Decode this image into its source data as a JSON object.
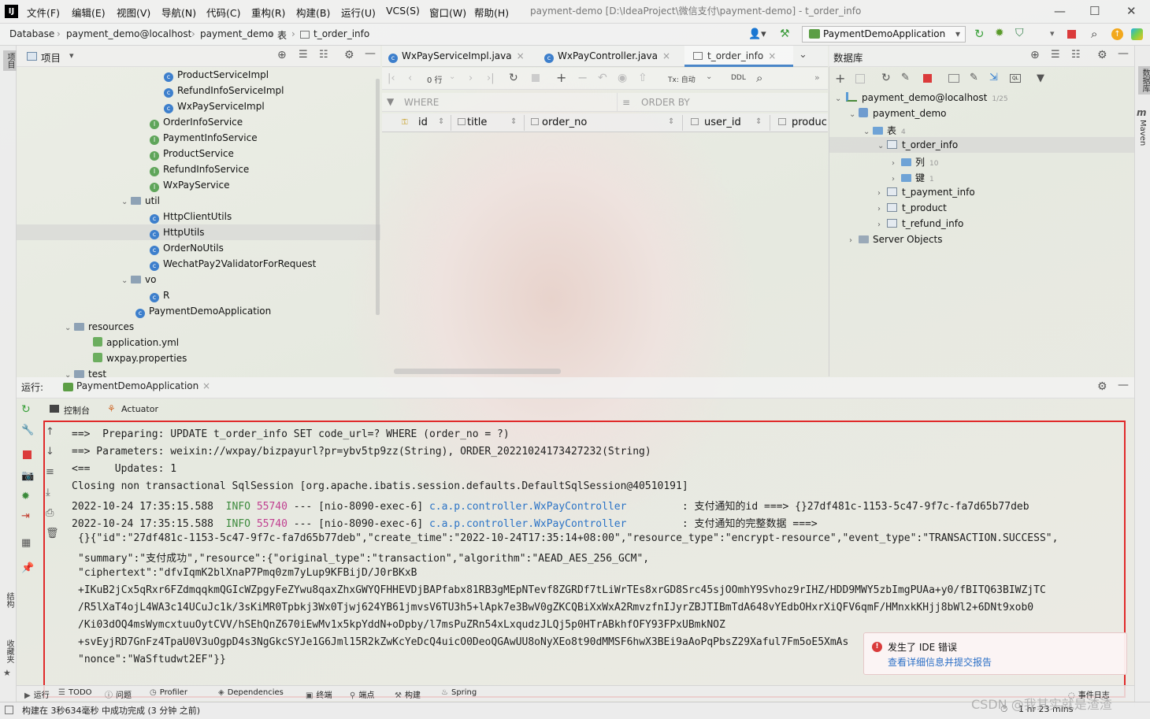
{
  "menu": {
    "items": [
      "文件(F)",
      "编辑(E)",
      "视图(V)",
      "导航(N)",
      "代码(C)",
      "重构(R)",
      "构建(B)",
      "运行(U)",
      "VCS(S)",
      "窗口(W)",
      "帮助(H)"
    ]
  },
  "window": {
    "title": "payment-demo [D:\\IdeaProject\\微信支付\\payment-demo] - t_order_info"
  },
  "breadcrumb": [
    "Database",
    "payment_demo@localhost",
    "payment_demo",
    "表",
    "t_order_info"
  ],
  "run_config": "PaymentDemoApplication",
  "project": {
    "title": "项目",
    "items": [
      {
        "label": "ProductServiceImpl",
        "kind": "class",
        "indent": 3
      },
      {
        "label": "RefundInfoServiceImpl",
        "kind": "class",
        "indent": 3
      },
      {
        "label": "WxPayServiceImpl",
        "kind": "class",
        "indent": 3
      },
      {
        "label": "OrderInfoService",
        "kind": "interface",
        "indent": 2
      },
      {
        "label": "PaymentInfoService",
        "kind": "interface",
        "indent": 2
      },
      {
        "label": "ProductService",
        "kind": "interface",
        "indent": 2
      },
      {
        "label": "RefundInfoService",
        "kind": "interface",
        "indent": 2
      },
      {
        "label": "WxPayService",
        "kind": "interface",
        "indent": 2
      },
      {
        "label": "util",
        "kind": "folder",
        "indent": 1,
        "open": true
      },
      {
        "label": "HttpClientUtils",
        "kind": "class",
        "indent": 2
      },
      {
        "label": "HttpUtils",
        "kind": "class",
        "indent": 2
      },
      {
        "label": "OrderNoUtils",
        "kind": "class",
        "indent": 2
      },
      {
        "label": "WechatPay2ValidatorForRequest",
        "kind": "class",
        "indent": 2
      },
      {
        "label": "vo",
        "kind": "folder",
        "indent": 1,
        "open": true
      },
      {
        "label": "R",
        "kind": "class",
        "indent": 2
      },
      {
        "label": "PaymentDemoApplication",
        "kind": "class",
        "indent": 1
      },
      {
        "label": "resources",
        "kind": "folder",
        "indent": 0,
        "open": true
      },
      {
        "label": "application.yml",
        "kind": "yml",
        "indent": 1
      },
      {
        "label": "wxpay.properties",
        "kind": "yml",
        "indent": 1
      },
      {
        "label": "test",
        "kind": "folder",
        "indent": 0,
        "open": true
      }
    ]
  },
  "editor": {
    "tabs": [
      "WxPayServiceImpl.java",
      "WxPayController.java",
      "t_order_info"
    ],
    "rows_label": "0 行",
    "tx_label": "Tx: 自动",
    "ddl_label": "DDL",
    "where_label": "WHERE",
    "orderby_label": "ORDER BY",
    "columns": [
      "id",
      "title",
      "order_no",
      "user_id",
      "produc"
    ]
  },
  "database": {
    "title": "数据库",
    "nodes": [
      {
        "label": "payment_demo@localhost",
        "badge": "1/25",
        "level": 0,
        "arrow": "open"
      },
      {
        "label": "payment_demo",
        "badge": "",
        "level": 1,
        "arrow": "open"
      },
      {
        "label": "表",
        "badge": "4",
        "level": 2,
        "arrow": "open"
      },
      {
        "label": "t_order_info",
        "badge": "",
        "level": 3,
        "arrow": "open"
      },
      {
        "label": "列",
        "badge": "10",
        "level": 4,
        "arrow": "closed"
      },
      {
        "label": "键",
        "badge": "1",
        "level": 4,
        "arrow": "closed"
      },
      {
        "label": "t_payment_info",
        "badge": "",
        "level": 3,
        "arrow": "closed"
      },
      {
        "label": "t_product",
        "badge": "",
        "level": 3,
        "arrow": "closed"
      },
      {
        "label": "t_refund_info",
        "badge": "",
        "level": 3,
        "arrow": "closed"
      },
      {
        "label": "Server Objects",
        "badge": "",
        "level": 1,
        "arrow": "closed"
      }
    ]
  },
  "run": {
    "label": "运行:",
    "tab": "PaymentDemoApplication",
    "console_tab": "控制台",
    "actuator_tab": "Actuator"
  },
  "console": {
    "lines": [
      "==>  Preparing: UPDATE t_order_info SET code_url=? WHERE (order_no = ?)",
      "==> Parameters: weixin://wxpay/bizpayurl?pr=ybv5tp9zz(String), ORDER_20221024173427232(String)",
      "<==    Updates: 1",
      "Closing non transactional SqlSession [org.apache.ibatis.session.defaults.DefaultSqlSession@40510191]"
    ],
    "log": [
      {
        "ts": "2022-10-24 17:35:15.588",
        "level": "INFO",
        "pid": "55740",
        "thread": "--- [nio-8090-exec-6]",
        "logger": "c.a.p.controller.WxPayController",
        "msg": ": 支付通知的id ===> {}27df481c-1153-5c47-9f7c-fa7d65b77deb"
      },
      {
        "ts": "2022-10-24 17:35:15.588",
        "level": "INFO",
        "pid": "55740",
        "thread": "--- [nio-8090-exec-6]",
        "logger": "c.a.p.controller.WxPayController",
        "msg": ": 支付通知的完整数据 ===>"
      }
    ],
    "json_lines": [
      "{}{\"id\":\"27df481c-1153-5c47-9f7c-fa7d65b77deb\",\"create_time\":\"2022-10-24T17:35:14+08:00\",\"resource_type\":\"encrypt-resource\",\"event_type\":\"TRANSACTION.SUCCESS\",",
      "\"summary\":\"支付成功\",\"resource\":{\"original_type\":\"transaction\",\"algorithm\":\"AEAD_AES_256_GCM\",",
      "\"ciphertext\":\"dfvIqmK2blXnaP7Pmq0zm7yLup9KFBijD/J0rBKxB",
      "+IKuB2jCx5qRxr6FZdmqqkmQGIcWZpgyFeZYwu8qaxZhxGWYQFHHEVDjBAPfabx81RB3gMEpNTevf8ZGRDf7tLiWrTEs8xrGD8Src45sjOOmhY9Svhoz9rIHZ/HDD9MWY5zbImgPUAa+y0/fBITQ63BIWZjTC",
      "/R5lXaT4ojL4WA3c14UCuJc1k/3sKiMR0Tpbkj3Wx0Tjwj624YB61jmvsV6TU3h5+lApk7e3BwV0gZKCQBiXxWxA2RmvzfnIJyrZBJTIBmTdA648vYEdbOHxrXiQFV6qmF/HMnxkKHjj8bWl2+6DNt9xob0",
      "/Ki03dOQ4msWymcxtuuOytCVV/hSEhQnZ670iEwMv1x5kpYddN+oDpby/l7msPuZRn54xLxqudzJLQj5p0HTrABkhfOFY93FPxUBmkNOZ",
      "+svEyjRD7GnFz4TpaU0V3uOgpD4s3NgGkcSYJe1G6Jml15R2kZwKcYeDcQ4uicO0DeoQGAwUU8oNyXEo8t90dMMSF6hwX3BEi9aAoPqPbsZ29Xaful7Fm5oE5XmAs",
      "\"nonce\":\"WaSftudwt2EF\"}}"
    ]
  },
  "bottom_tabs": [
    "运行",
    "TODO",
    "问题",
    "Profiler",
    "Dependencies",
    "终端",
    "端点",
    "构建",
    "Spring",
    "事件日志"
  ],
  "status": {
    "left": "构建在 3秒634毫秒 中成功完成 (3 分钟 之前)",
    "right": "1 hr 23 mins"
  },
  "notification": {
    "title": "发生了 IDE 错误",
    "link": "查看详细信息并提交报告"
  },
  "watermark": "CSDN @我其实就是渣渣"
}
